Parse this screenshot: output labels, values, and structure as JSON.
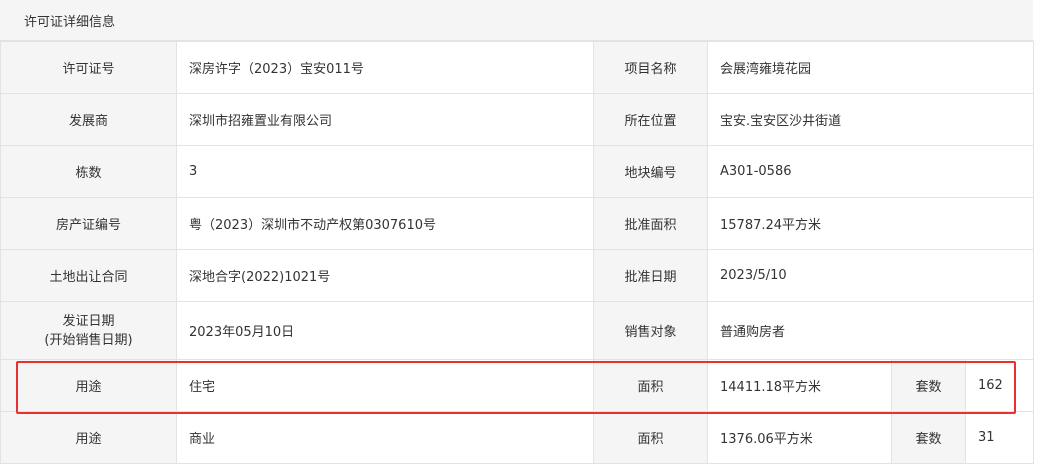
{
  "header": {
    "title": "许可证详细信息"
  },
  "rows": [
    {
      "l1": "许可证号",
      "v1": "深房许字（2023）宝安011号",
      "l2": "项目名称",
      "v2": "会展湾雍境花园"
    },
    {
      "l1": "发展商",
      "v1": "深圳市招雍置业有限公司",
      "l2": "所在位置",
      "v2": "宝安.宝安区沙井街道"
    },
    {
      "l1": "栋数",
      "v1": "3",
      "l2": "地块编号",
      "v2": "A301-0586"
    },
    {
      "l1": "房产证编号",
      "v1": "粤（2023）深圳市不动产权第0307610号",
      "l2": "批准面积",
      "v2": "15787.24平方米"
    },
    {
      "l1": "土地出让合同",
      "v1": "深地合字(2022)1021号",
      "l2": "批准日期",
      "v2": "2023/5/10"
    },
    {
      "l1a": "发证日期",
      "l1b": "(开始销售日期)",
      "v1": "2023年05月10日",
      "l2": "销售对象",
      "v2": "普通购房者"
    }
  ],
  "usage_rows": [
    {
      "usage_label": "用途",
      "usage": "住宅",
      "area_label": "面积",
      "area": "14411.18平方米",
      "units_label": "套数",
      "units": "162"
    },
    {
      "usage_label": "用途",
      "usage": "商业",
      "area_label": "面积",
      "area": "1376.06平方米",
      "units_label": "套数",
      "units": "31"
    }
  ],
  "colors": {
    "label_bg": "#f5f5f5",
    "border": "#e3e3e3",
    "highlight": "#e8302f"
  }
}
